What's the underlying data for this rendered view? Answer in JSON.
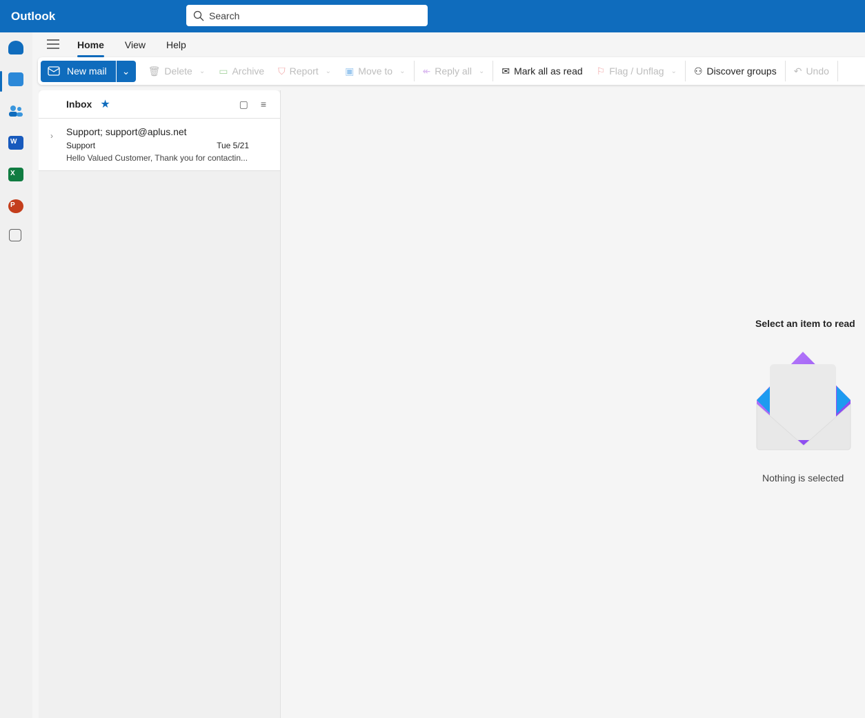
{
  "app": {
    "title": "Outlook"
  },
  "search": {
    "placeholder": "Search"
  },
  "rail": [
    "mail-icon",
    "calendar-icon",
    "people-icon",
    "word-icon",
    "excel-icon",
    "powerpoint-icon",
    "apps-icon"
  ],
  "tabs": [
    {
      "label": "Home",
      "selected": true
    },
    {
      "label": "View"
    },
    {
      "label": "Help"
    }
  ],
  "ribbon": {
    "new_mail": "New mail",
    "delete": "Delete",
    "archive": "Archive",
    "report": "Report",
    "move_to": "Move to",
    "reply_all": "Reply all",
    "mark_all_read": "Mark all as read",
    "flag": "Flag / Unflag",
    "discover_groups": "Discover groups",
    "undo": "Undo"
  },
  "folder": {
    "name": "Inbox"
  },
  "messages": [
    {
      "from": "Support; support@aplus.net",
      "subject": "Support",
      "date": "Tue 5/21",
      "preview": "Hello Valued Customer, Thank you for contactin..."
    }
  ],
  "reading": {
    "title": "Select an item to read",
    "subtitle": "Nothing is selected"
  },
  "colors": {
    "brand": "#0f6cbd"
  }
}
